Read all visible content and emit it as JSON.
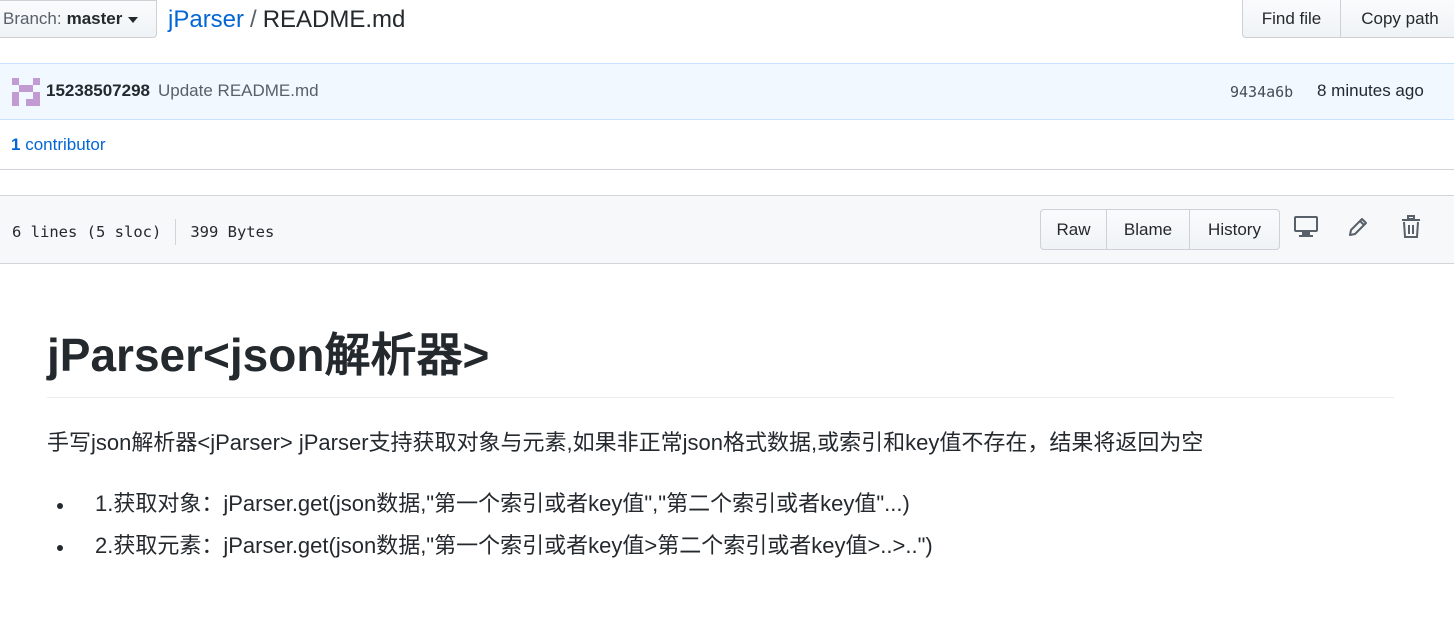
{
  "topbar": {
    "branch_label": "Branch:",
    "branch_value": "master",
    "repo_name": "jParser",
    "separator": "/",
    "file_name": "README.md",
    "find_file": "Find file",
    "copy_path": "Copy path"
  },
  "commit": {
    "author": "15238507298",
    "message": "Update README.md",
    "sha": "9434a6b",
    "time": "8 minutes ago"
  },
  "contributors": {
    "count": "1",
    "label": "contributor"
  },
  "file_header": {
    "lines": "6 lines (5 sloc)",
    "size": "399 Bytes",
    "raw": "Raw",
    "blame": "Blame",
    "history": "History",
    "icons": [
      "desktop-icon",
      "pencil-icon",
      "trash-icon"
    ]
  },
  "readme": {
    "title": "jParser<json解析器>",
    "intro": "手写json解析器<jParser> jParser支持获取对象与元素,如果非正常json格式数据,或索引和key值不存在，结果将返回为空",
    "items": [
      "1.获取对象：jParser.get(json数据,\"第一个索引或者key值\",\"第二个索引或者key值\"...)",
      "2.获取元素：jParser.get(json数据,\"第一个索引或者key值>第二个索引或者key值>..>..\")"
    ]
  },
  "colors": {
    "link": "#0366d6",
    "commit_bg": "#f1f8ff",
    "header_bg": "#f6f8fa",
    "text": "#24292e",
    "avatar": "#c39bd3"
  }
}
